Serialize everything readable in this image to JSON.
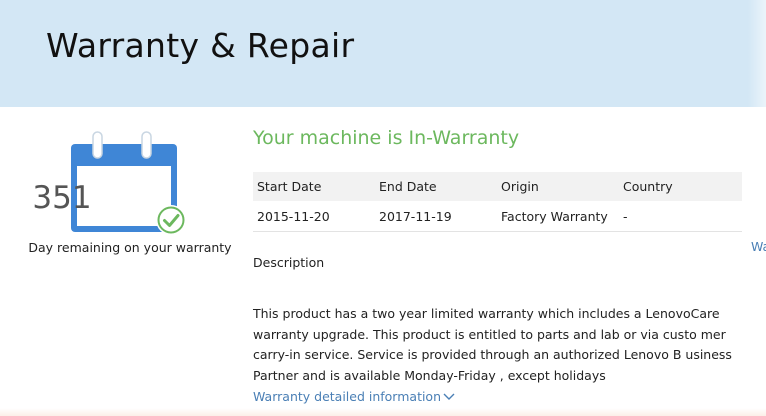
{
  "header": {
    "title": "Warranty & Repair"
  },
  "warranty": {
    "days_remaining": "351",
    "days_caption": "Day remaining on your warranty",
    "status": "Your machine is In-Warranty",
    "table": {
      "headers": [
        "Start Date",
        "End Date",
        "Origin",
        "Country"
      ],
      "rows": [
        [
          "2015-11-20",
          "2017-11-19",
          "Factory Warranty",
          "-"
        ]
      ]
    },
    "side_link_fragment": "Wa",
    "description_label": "Description",
    "description": "This product has a two year limited warranty which includes a LenovoCare warranty upgrade. This product is entitled to parts and lab or via custo mer carry-in service. Service is provided through an authorized Lenovo B usiness Partner and is available Monday-Friday , except holidays",
    "detail_link": "Warranty detailed information"
  },
  "colors": {
    "banner": "#d3e7f5",
    "status_green": "#6cb85e",
    "calendar_blue": "#3f86d6",
    "link_blue": "#4a7fb5"
  },
  "icons": [
    "calendar-icon",
    "checkmark-icon",
    "chevron-down-icon"
  ]
}
